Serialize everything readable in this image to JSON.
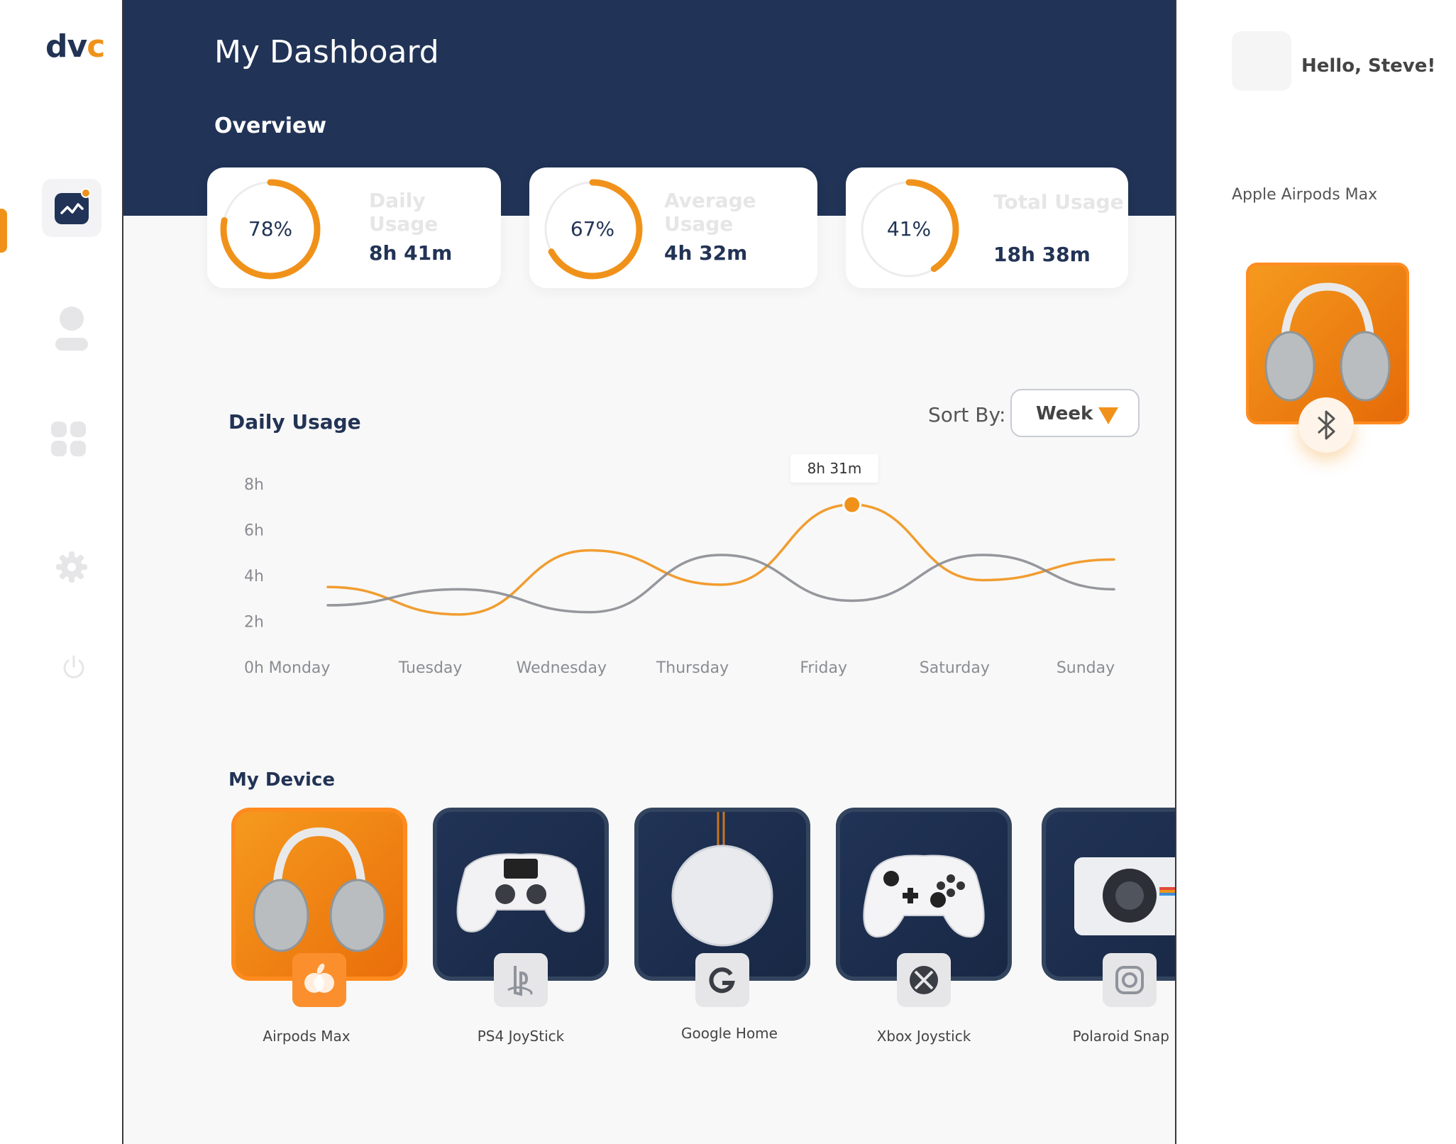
{
  "app": {
    "logo_text": "dv",
    "logo_accent": "c",
    "accent_color": "#f0921a",
    "navy_color": "#213356"
  },
  "sidebar": {
    "items": [
      {
        "icon": "analytics-icon",
        "active": true
      },
      {
        "icon": "user-icon",
        "active": false
      },
      {
        "icon": "grid-icon",
        "active": false
      },
      {
        "icon": "gear-icon",
        "active": false
      },
      {
        "icon": "power-icon",
        "active": false
      }
    ]
  },
  "header": {
    "title": "My Dashboard",
    "overview": "Overview"
  },
  "stats": [
    {
      "percent": "78%",
      "percent_value": 78,
      "label": "Daily Usage",
      "value": "8h 41m"
    },
    {
      "percent": "67%",
      "percent_value": 67,
      "label": "Average Usage",
      "value": "4h 32m"
    },
    {
      "percent": "41%",
      "percent_value": 41,
      "label": "Total Usage",
      "value": "18h 38m"
    }
  ],
  "usage": {
    "title": "Daily Usage",
    "sort_label": "Sort By:",
    "sort_value": "Week",
    "tooltip": "8h 31m"
  },
  "chart_data": {
    "type": "line",
    "title": "Daily Usage",
    "categories": [
      "Monday",
      "Tuesday",
      "Wednesday",
      "Thursday",
      "Friday",
      "Saturday",
      "Sunday"
    ],
    "y_ticks": [
      "8h",
      "6h",
      "4h",
      "2h",
      "0h"
    ],
    "ylim": [
      0,
      8
    ],
    "series": [
      {
        "color": "#f0921a",
        "values": [
          3.5,
          2.3,
          5.1,
          3.6,
          7.1,
          3.8,
          4.7
        ]
      },
      {
        "color": "#8a8c92",
        "values": [
          2.7,
          3.4,
          2.4,
          4.9,
          2.9,
          4.9,
          3.4
        ]
      }
    ],
    "highlight": {
      "category": "Friday",
      "value": 7.1,
      "label": "8h 31m"
    }
  },
  "devices": {
    "title": "My Device",
    "items": [
      {
        "name": "Airpods Max",
        "theme": "orange",
        "icon": "headphones-icon",
        "brand_icon": "apple-icon"
      },
      {
        "name": "PS4 JoyStick",
        "theme": "navy",
        "icon": "gamepad-icon",
        "brand_icon": "playstation-icon"
      },
      {
        "name": "Google Home",
        "theme": "navy",
        "icon": "speaker-icon",
        "brand_icon": "google-icon"
      },
      {
        "name": "Xbox Joystick",
        "theme": "navy",
        "icon": "xbox-controller-icon",
        "brand_icon": "xbox-icon"
      },
      {
        "name": "Polaroid Snap",
        "theme": "navy",
        "icon": "camera-icon",
        "brand_icon": "instagram-icon"
      }
    ]
  },
  "right_panel": {
    "greeting": "Hello, Steve!",
    "device_name": "Apple Airpods Max",
    "device_icon": "headphones-icon",
    "action_icon": "bluetooth-icon"
  }
}
